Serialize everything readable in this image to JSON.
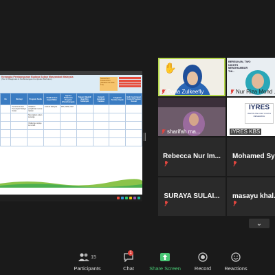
{
  "shared_doc": {
    "title": "Kerangka Pembangunan Budaya Sukan Masyarakat Malaysia",
    "subtitle": "(Tier 3: Diagnosis & Perbincangan Kumpulan Berfokus)",
    "note": "",
    "badge_text": "Sesuai Beri Keseluruhan (Tiktakan Ok Nilai 1%)",
    "badge_items": [
      "",
      "",
      " ",
      ""
    ],
    "columns": [
      "No",
      "Strategi",
      "Program Sedia",
      "Pelaksanaan Aspek Mikro",
      "Agensi Pelaksana Program (Penerbangan)",
      "Tujuan Objektif Bagi Dan Sebanyak",
      "Tempoh Jangkaan Capaian",
      "Jangkaan Sumber Impak",
      "Soft Cost Impact Contoh Program Sesuai"
    ],
    "rows": [
      [
        "",
        "Penasmuan dan Penerapan Budaya Sukan",
        "Galakkan penglibatan semua lapisan",
        "Institusi Malaysia",
        "KBS, KPM, KKM",
        "",
        "",
        "",
        ""
      ],
      [
        "",
        "",
        "Menetapkan sukan keluarga",
        "",
        "",
        "",
        "",
        "",
        ""
      ],
      [
        "",
        "",
        "Challenge supaya ke rumah",
        "",
        "",
        "",
        "",
        "",
        ""
      ],
      [
        "",
        "",
        "",
        "",
        "",
        "",
        "",
        "",
        ""
      ],
      [
        "",
        "",
        "",
        "",
        "",
        "",
        "",
        "",
        ""
      ]
    ]
  },
  "participants_gallery": [
    {
      "name": "Dana Zulkeefly",
      "type": "video",
      "active": true,
      "muted": true,
      "raised_hand": true
    },
    {
      "name": "Nur Riza Mohd ...",
      "type": "video",
      "muted": true
    },
    {
      "name": "sharifah ma...",
      "type": "video",
      "muted": true
    },
    {
      "name": "IYRES KBS",
      "type": "video",
      "muted": false
    },
    {
      "name": "Rebecca Nur Im...",
      "type": "name",
      "muted": true
    },
    {
      "name": "Mohamed Sya...",
      "type": "name",
      "muted": true
    },
    {
      "name": "SURAYA SULAI...",
      "type": "name",
      "muted": true
    },
    {
      "name": "masayu khal...",
      "type": "name",
      "muted": true
    }
  ],
  "iyres_logo": {
    "text": "IYRES",
    "subtext": "INSTITUTE FOR YOUTH RESEARCH"
  },
  "riza_tile_text": "BERSUKAN, TWO NIGHTS MENGHAMBUR THI...",
  "toolbar": {
    "participants_label": "Participants",
    "participants_count": "15",
    "chat_label": "Chat",
    "chat_badge": "1",
    "share_label": "Share Screen",
    "record_label": "Record",
    "reactions_label": "Reactions"
  },
  "colors": {
    "active_speaker": "#b6d94c",
    "share_green": "#48c774",
    "muted_red": "#e2463f",
    "table_header": "#3a7cc2"
  }
}
